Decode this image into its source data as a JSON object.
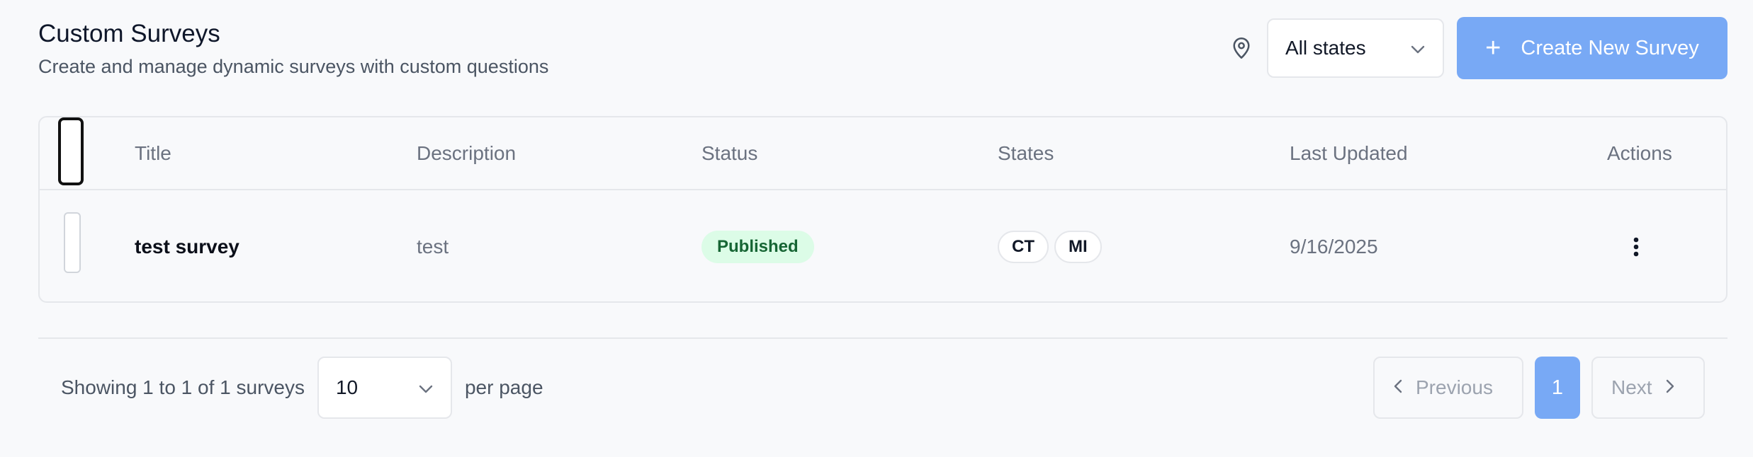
{
  "header": {
    "title": "Custom Surveys",
    "subtitle": "Create and manage dynamic surveys with custom questions"
  },
  "toolbar": {
    "location_icon": "map-pin-icon",
    "state_filter": {
      "selected": "All states",
      "icon": "chevron-down-icon"
    },
    "create_button": {
      "label": "Create New Survey",
      "icon": "plus-icon"
    }
  },
  "table": {
    "columns": [
      "Title",
      "Description",
      "Status",
      "States",
      "Last Updated",
      "Actions"
    ],
    "rows": [
      {
        "title": "test survey",
        "description": "test",
        "status": "Published",
        "states": [
          "CT",
          "MI"
        ],
        "last_updated": "9/16/2025",
        "actions_icon": "more-vertical-icon"
      }
    ]
  },
  "footer": {
    "showing": "Showing 1 to 1 of 1 surveys",
    "per_page": "10",
    "per_page_label": "per page",
    "pagination": {
      "previous": "Previous",
      "current_page": "1",
      "next": "Next"
    }
  },
  "colors": {
    "primary": "#78a9f5",
    "status_published_bg": "#dcfce7",
    "status_published_text": "#166534",
    "border": "#e5e7eb",
    "background": "#f8f9fb"
  }
}
